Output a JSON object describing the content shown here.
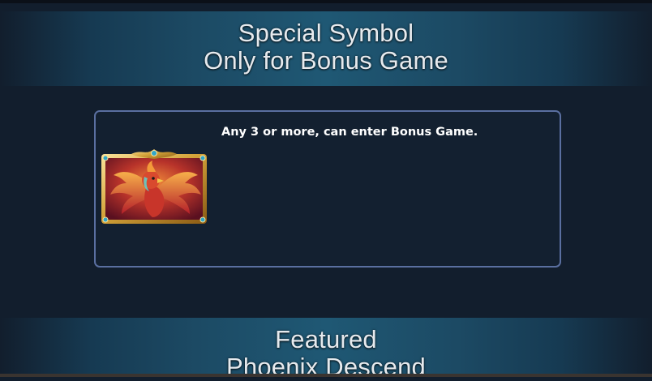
{
  "header": {
    "line1": "Special Symbol",
    "line2": "Only for Bonus Game"
  },
  "symbol_card": {
    "symbol_icon": "phoenix-bonus-symbol-icon",
    "description": "Any 3 or more, can enter Bonus Game."
  },
  "footer_banner": {
    "line1": "Featured",
    "line2": "Phoenix Descend"
  },
  "colors": {
    "background": "#121e2d",
    "banner_center": "#1f5874",
    "card_border": "#5a6fa0",
    "frame_gold": "#d4a43a",
    "phoenix_red": "#c8352a"
  }
}
